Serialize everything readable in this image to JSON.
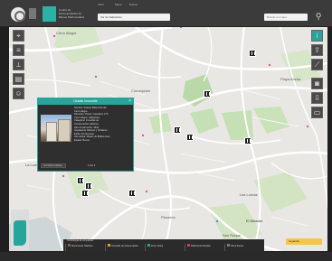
{
  "header": {
    "brand_text": "Centro de Documentación de Bienes Patrimoniales",
    "tabs": [
      "Inicio",
      "Mapa",
      "Buscar"
    ],
    "search_value": "Ver de Valparaíso",
    "search_placeholder": "Buscar en mapa"
  },
  "map": {
    "labels": {
      "cerro_alegre": "Cerro Alegre",
      "concepcion": "Concepción",
      "la_loma": "La Loma",
      "las_lomas": "Las Lomas",
      "placeres": "Placeres",
      "el_mirador": "El Mirador",
      "playa_ancha": "Playa Ancha",
      "san_roque": "San Roque"
    }
  },
  "popup": {
    "title": "Detalle Inmueble",
    "lines": [
      "Nombre: Palacio Baburizza del",
      "Cerro Alegre",
      "Dirección: Paseo Yugoslavo 176",
      "Cerro Alegre, Valparaíso",
      "Categoría: Inmueble de",
      "Conservación Histórica",
      "Año construcción: 1916",
      "Arquitectos: Barison y Schiavon",
      "Estilo: Art Nouveau",
      "Uso actual: Museo de Bellas Artes",
      "Estado: Bueno"
    ],
    "footer_label": "Ver ficha completa",
    "pager": "1 de 3"
  },
  "bottom_strip": {
    "heading": "Simbología de inmuebles",
    "items": [
      {
        "label": "Monumento Histórico",
        "color": "#8b5e3c"
      },
      {
        "label": "Inmueble de Conservación",
        "color": "#d7a23a"
      },
      {
        "label": "Zona Típica",
        "color": "#26a69a"
      },
      {
        "label": "Patrimonio Mundial",
        "color": "#c2415d"
      },
      {
        "label": "Otros bienes",
        "color": "#7a7a7a"
      }
    ],
    "action_label": "Leyenda"
  },
  "colors": {
    "accent": "#26a69a",
    "map_bg": "#e9e7e3",
    "highlight": "#f6c54a"
  }
}
